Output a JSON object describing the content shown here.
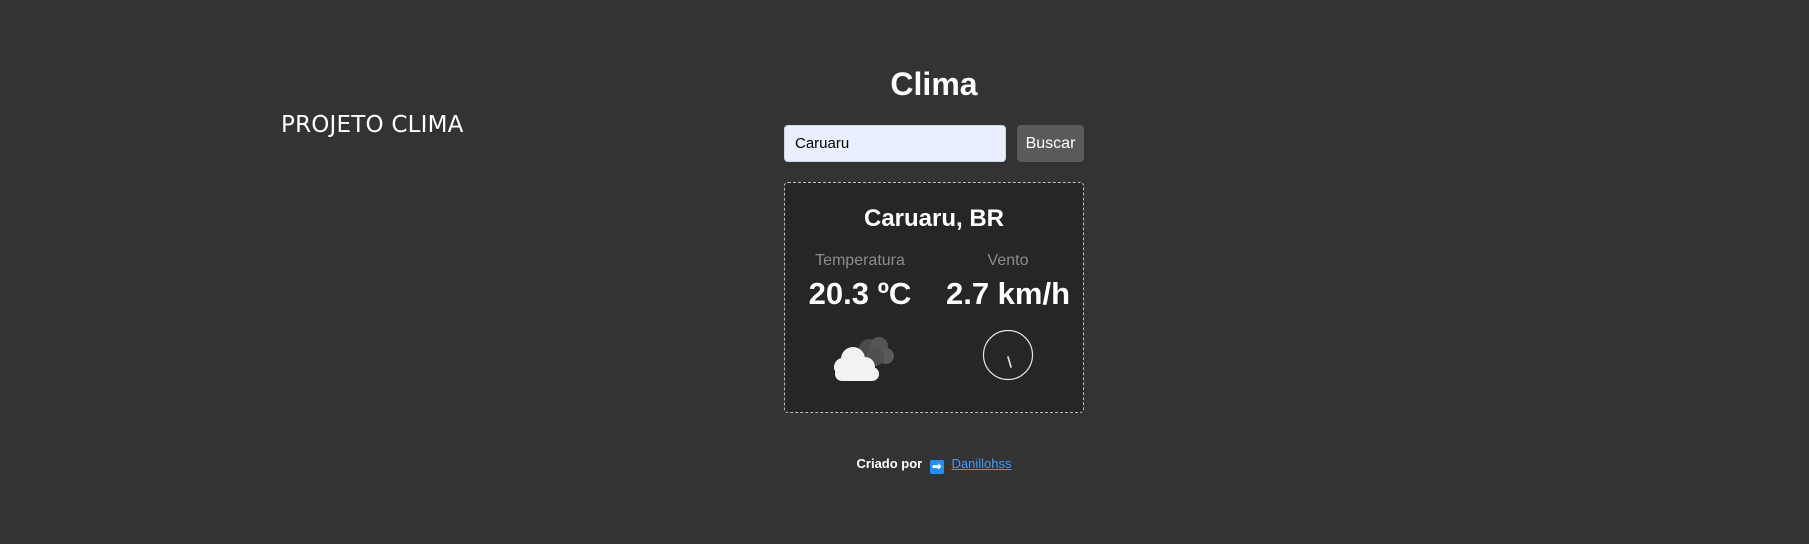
{
  "side_title": "PROJETO CLIMA",
  "title": "Clima",
  "search": {
    "value": "Caruaru",
    "button_label": "Buscar"
  },
  "weather": {
    "city": "Caruaru, BR",
    "temperature_label": "Temperatura",
    "temperature_value": "20.3 ºC",
    "wind_label": "Vento",
    "wind_value": "2.7 km/h",
    "condition_icon": "cloud-icon",
    "wind_icon": "wind-direction-icon"
  },
  "footer": {
    "prefix": "Criado por",
    "arrow": "➡",
    "author": "Danillohss"
  },
  "colors": {
    "background": "#333333",
    "card_background": "#262626",
    "input_background": "#e8f0fe",
    "button_background": "#5a5a5a",
    "link": "#3b9cff"
  }
}
